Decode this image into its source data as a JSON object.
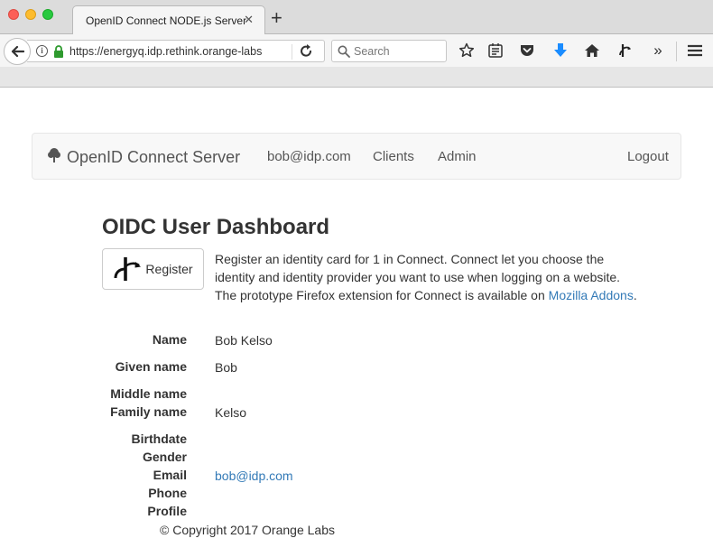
{
  "browser": {
    "tab_title": "OpenID Connect NODE.js Server",
    "tab_close_glyph": "✕",
    "new_tab_glyph": "+",
    "url": "https://energyq.idp.rethink.orange-labs",
    "search_placeholder": "Search",
    "overflow_glyph": "»",
    "icons": [
      "back-arrow-icon",
      "info-icon",
      "lock-icon",
      "reload-icon",
      "search-icon",
      "bookmark-star-icon",
      "reading-list-icon",
      "pocket-icon",
      "download-icon",
      "home-icon",
      "openid-extension-icon",
      "overflow-chevron-icon",
      "menu-icon"
    ]
  },
  "site_nav": {
    "brand": "OpenID Connect Server",
    "brand_icon": "tree-icon",
    "user": "bob@idp.com",
    "clients": "Clients",
    "admin": "Admin",
    "logout": "Logout"
  },
  "dashboard": {
    "title": "OIDC User Dashboard",
    "register_label": "Register",
    "intro_text": "Register an identity card for 1 in Connect. Connect let you choose the identity and identity provider you want to use when logging on a website. The prototype Firefox extension for Connect is available on ",
    "intro_link": "Mozilla Addons",
    "intro_end": "."
  },
  "profile": {
    "name_label": "Name",
    "name_value": "Bob Kelso",
    "given_label": "Given name",
    "given_value": "Bob",
    "middle_label": "Middle name",
    "middle_value": "",
    "family_label": "Family name",
    "family_value": "Kelso",
    "birthdate_label": "Birthdate",
    "birthdate_value": "",
    "gender_label": "Gender",
    "gender_value": "",
    "email_label": "Email",
    "email_value": "bob@idp.com",
    "phone_label": "Phone",
    "phone_value": "",
    "profile_label": "Profile",
    "profile_value": ""
  },
  "footer": {
    "copyright": "© Copyright 2017 Orange Labs"
  },
  "colors": {
    "link": "#337ab7",
    "download_arrow": "#1a8cff",
    "lock_green": "#2e9a2e"
  }
}
